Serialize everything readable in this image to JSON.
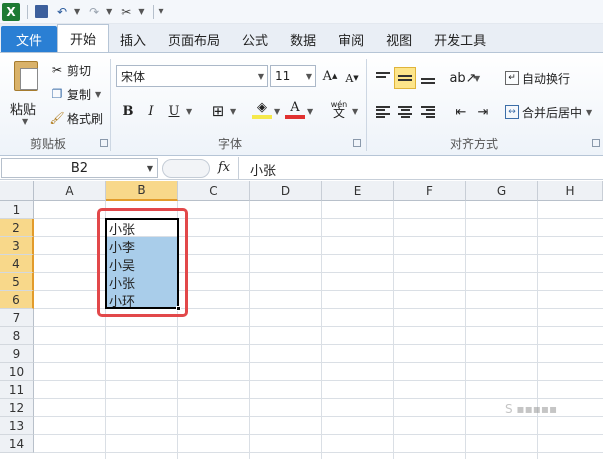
{
  "quick_access": {
    "icons": [
      "excel-logo-icon",
      "save-icon",
      "undo-icon",
      "redo-icon",
      "customize-icon"
    ]
  },
  "tabs": [
    "文件",
    "开始",
    "插入",
    "页面布局",
    "公式",
    "数据",
    "审阅",
    "视图",
    "开发工具"
  ],
  "ribbon": {
    "clipboard": {
      "paste": "粘贴",
      "cut": "剪切",
      "copy": "复制",
      "format_painter": "格式刷",
      "label": "剪贴板"
    },
    "font": {
      "name": "宋体",
      "size": "11",
      "bold": "B",
      "italic": "I",
      "underline": "U",
      "font_color_label": "A",
      "wen": "wén\n文",
      "label": "字体"
    },
    "alignment": {
      "wrap_text": "自动换行",
      "merge_center": "合并后居中",
      "label": "对齐方式"
    }
  },
  "formula_bar": {
    "name_box": "B2",
    "fx": "fx",
    "value": "小张"
  },
  "sheet": {
    "columns": [
      "A",
      "B",
      "C",
      "D",
      "E",
      "F",
      "G",
      "H"
    ],
    "rows": [
      "1",
      "2",
      "3",
      "4",
      "5",
      "6",
      "7",
      "8",
      "9",
      "10",
      "11",
      "12",
      "13",
      "14"
    ],
    "selected_column": "B",
    "selected_rows": [
      "2",
      "3",
      "4",
      "5",
      "6"
    ],
    "cells_B": [
      "小张",
      "小李",
      "小吴",
      "小张",
      "小环"
    ]
  },
  "colors": {
    "file_tab": "#2a7fd4",
    "selection": "#a9cdea",
    "header_selected": "#f8d88a",
    "annotation_red": "#e2484a"
  }
}
